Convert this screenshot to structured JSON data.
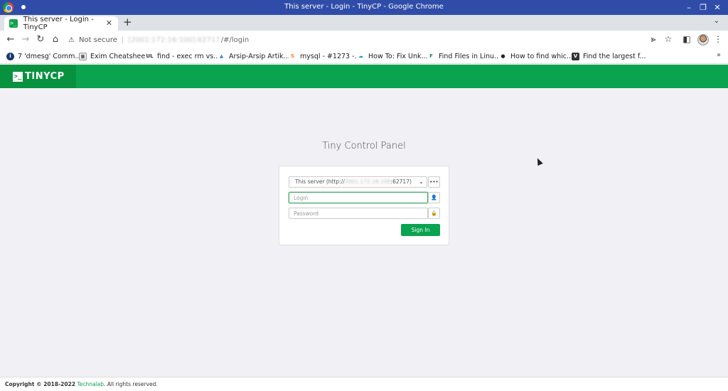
{
  "window": {
    "title": "This server - Login - TinyCP - Google Chrome",
    "minimize_icon": "minimize-icon",
    "restore_icon": "restore-icon",
    "close_icon": "close-icon"
  },
  "tabs": [
    {
      "label": "This server - Login - TinyCP",
      "favicon": ">_",
      "active": true
    }
  ],
  "toolbar": {
    "security_label": "Not secure",
    "url_host": "[2001:172:16:100]:62717",
    "url_path": "/#/login",
    "new_tab_label": "+"
  },
  "bookmarks": [
    {
      "label": "7 'dmesg' Comm...",
      "color": "#1a3a6b",
      "glyph": "i"
    },
    {
      "label": "Exim Cheatsheet",
      "color": "#e8e8e8",
      "glyph": "B"
    },
    {
      "label": "find - exec rm vs...",
      "color": "#ffffff",
      "glyph": "UL"
    },
    {
      "label": "Arsip-Arsip Artik...",
      "color": "#3a8fd8",
      "glyph": "▲"
    },
    {
      "label": "mysql - #1273 -...",
      "color": "#f48024",
      "glyph": "S"
    },
    {
      "label": "How To: Fix Unk...",
      "color": "#0b9de3",
      "glyph": "☁"
    },
    {
      "label": "Find Files in Linu...",
      "color": "#1a7f4b",
      "glyph": "F"
    },
    {
      "label": "How to find whic...",
      "color": "#222222",
      "glyph": "●"
    },
    {
      "label": "Find the largest f...",
      "color": "#333333",
      "glyph": "V"
    }
  ],
  "app": {
    "brand_icon": ">_",
    "brand_name": "TINYCP",
    "brand_color": "#0aa34f"
  },
  "login": {
    "heading": "Tiny Control Panel",
    "server_select_prefix": "This server (http://",
    "server_select_host": "2001:172:16:100",
    "server_select_suffix": ":62717)",
    "more_label": "•••",
    "login_placeholder": "Login",
    "password_placeholder": "Password",
    "signin_label": "Sign In"
  },
  "footer": {
    "copyright": "Copyright © 2018-2022",
    "company": "Technalab",
    "rights": ". All rights reserved."
  }
}
